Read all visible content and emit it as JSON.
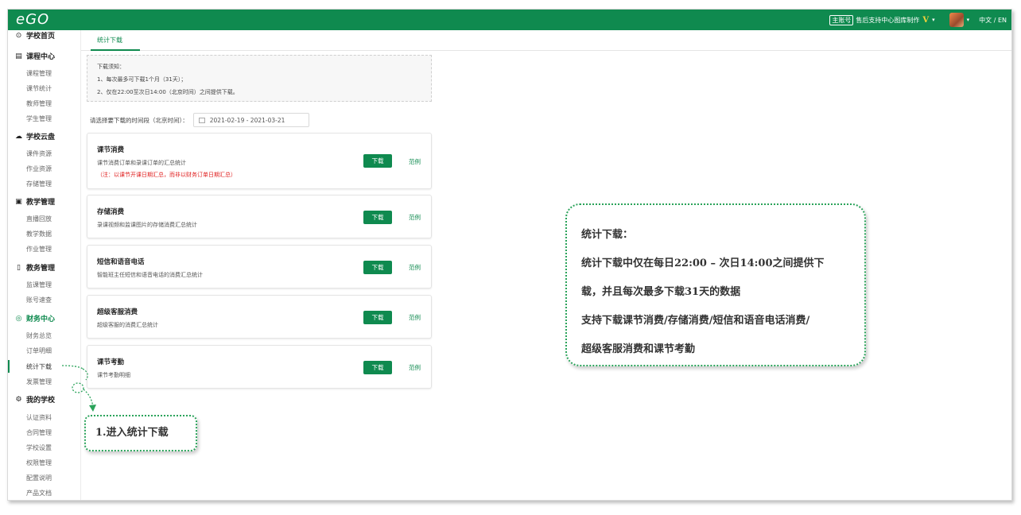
{
  "topbar": {
    "logo": "eGO",
    "account_badge": "主账号",
    "org_name": "售后支持中心图库制作",
    "vip": "V",
    "caret": "▾",
    "language": "中文 / EN"
  },
  "sidebar": {
    "sections": [
      {
        "icon": "⊙",
        "label": "学校首页"
      },
      {
        "icon": "▤",
        "label": "课程中心",
        "items": [
          "课程管理",
          "课节统计",
          "教师管理",
          "学生管理"
        ]
      },
      {
        "icon": "☁",
        "label": "学校云盘",
        "items": [
          "课件资源",
          "作业资源",
          "存储管理"
        ]
      },
      {
        "icon": "▣",
        "label": "教学管理",
        "items": [
          "直播回放",
          "教学数据",
          "作业管理"
        ]
      },
      {
        "icon": "▯",
        "label": "教务管理",
        "items": [
          "监课管理",
          "账号速查"
        ]
      },
      {
        "icon": "◎",
        "label": "财务中心",
        "items": [
          "财务总览",
          "订单明细",
          "统计下载",
          "发票管理"
        ]
      },
      {
        "icon": "⚙",
        "label": "我的学校",
        "items": [
          "认证资料",
          "合同管理",
          "学校设置",
          "权限管理",
          "配置说明",
          "产品文档"
        ]
      }
    ],
    "active_item": "统计下载"
  },
  "tab": {
    "label": "统计下载"
  },
  "notice": {
    "title": "下载须知：",
    "line1": "1、每次最多可下载1个月（31天）；",
    "line2": "2、仅在22:00至次日14:00（北京时间）之间提供下载。"
  },
  "date_range": {
    "label": "请选择要下载的时间段（北京时间）：",
    "value": "2021-02-19  -  2021-03-21"
  },
  "cards": [
    {
      "title": "课节消费",
      "desc": "课节消费订单和录课订单的汇总统计",
      "note": "（注：以课节开课日期汇总，而非以财务订单日期汇总）",
      "button": "下载",
      "example": "范例"
    },
    {
      "title": "存储消费",
      "desc": "录课视频和监课图片的存储消费汇总统计",
      "button": "下载",
      "example": "范例"
    },
    {
      "title": "短信和语音电话",
      "desc": "智能班主任短信和语音电话的消费汇总统计",
      "button": "下载",
      "example": "范例"
    },
    {
      "title": "超级客服消费",
      "desc": "超级客服的消费汇总统计",
      "button": "下载",
      "example": "范例"
    },
    {
      "title": "课节考勤",
      "desc": "课节考勤明细",
      "button": "下载",
      "example": "范例"
    }
  ],
  "callout_main": {
    "line1": "统计下载：",
    "line2": "统计下载中仅在每日22:00 – 次日14:00之间提供下",
    "line3": "载，并且每次最多下载31天的数据",
    "line4": "支持下载课节消费/存储消费/短信和语音电话消费/",
    "line5": "超级客服消费和课节考勤"
  },
  "callout_step": {
    "text": "1.进入统计下载"
  },
  "colors": {
    "brand": "#0f8a4f",
    "note_red": "#e02020",
    "callout_border": "#2aa35a"
  }
}
